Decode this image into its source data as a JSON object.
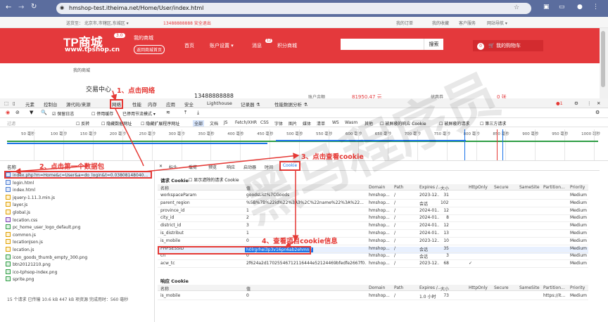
{
  "browser": {
    "url": "hmshop-test.itheima.net/Home/User/index.html"
  },
  "site": {
    "top_left": "送货至：  北京市,市辖区,东城区 ▾",
    "top_phone": "13488888888 安全退出",
    "top_links": [
      "我的订单",
      "我的收藏",
      "客户服务",
      "网站导航 ▾"
    ],
    "logo": "TP商城",
    "logo_badge": "3.0",
    "logo_url": "www.tpshop.cn",
    "my_shop": "我的商城",
    "back_home": "返回商城首页",
    "nav": [
      "首页",
      "账户设置 ▾",
      "消息",
      "积分商城"
    ],
    "msg_badge": "12",
    "search_btn": "搜索",
    "cart_count": "0",
    "cart_label": "我的购物车",
    "breadcrumb": "我的商城",
    "ucenter": "交易中心",
    "phone": "13488888888",
    "balance_label": "账户余额",
    "balance_value": "81950.47 元",
    "coupon_label": "优惠券",
    "coupon_value": "0 张"
  },
  "devtools": {
    "tabs": [
      "元素",
      "控制台",
      "源代码/来源",
      "网络",
      "性能",
      "内存",
      "应用",
      "安全",
      "Lighthouse",
      "记录器 ⚗",
      "性能数据分析 ⚗"
    ],
    "toolbar": {
      "preserve_log": "保留日志",
      "disable_cache": "停用缓存",
      "throttle": "已停用节流模式 ▾"
    },
    "filter": {
      "placeholder": "过滤",
      "invert": "反转",
      "hide_data": "隐藏数据网址",
      "hide_ext": "隐藏扩展程序网址",
      "chips": [
        "全部",
        "文档",
        "JS",
        "Fetch/XHR",
        "CSS",
        "字体",
        "图片",
        "媒体",
        "清单",
        "WS",
        "Wasm",
        "其他"
      ],
      "blocked_cookies": "被屏蔽的响应 Cookie",
      "blocked_requests": "被屏蔽的请求",
      "third_party": "第三方请求"
    },
    "ticks": [
      "50 毫秒",
      "100 毫秒",
      "150 毫秒",
      "200 毫秒",
      "250 毫秒",
      "300 毫秒",
      "350 毫秒",
      "400 毫秒",
      "450 毫秒",
      "500 毫秒",
      "550 毫秒",
      "600 毫秒",
      "650 毫秒",
      "700 毫秒",
      "750 毫秒",
      "800 毫秒",
      "850 毫秒",
      "900 毫秒",
      "950 毫秒",
      "1000 毫秒"
    ],
    "left_header": "名称",
    "files": [
      {
        "name": "index.php?m=Home&c=User&a=do_login&t=0.03808148040...",
        "t": "doc"
      },
      {
        "name": "login.html",
        "t": "doc"
      },
      {
        "name": "index.html",
        "t": "doc"
      },
      {
        "name": "jquery-1.11.3.min.js",
        "t": "js"
      },
      {
        "name": "layer.js",
        "t": "js"
      },
      {
        "name": "global.js",
        "t": "js"
      },
      {
        "name": "location.css",
        "t": "css"
      },
      {
        "name": "pc_home_user_logo_default.png",
        "t": "img"
      },
      {
        "name": "common.js",
        "t": "js"
      },
      {
        "name": "locationJson.js",
        "t": "js"
      },
      {
        "name": "location.js",
        "t": "js"
      },
      {
        "name": "icon_goods_thumb_empty_300.png",
        "t": "img"
      },
      {
        "name": "btn20121210.png",
        "t": "img"
      },
      {
        "name": "ico-tphsop-index.png",
        "t": "img"
      },
      {
        "name": "sprite.png",
        "t": "img"
      }
    ],
    "left_footer": "15 个请求    已传输 10.6 kB    447 kB 项资源    完成用时：560 毫秒",
    "right_tabs": [
      "标头",
      "载荷",
      "预览",
      "响应",
      "启动器",
      "时间",
      "Cookie"
    ],
    "req_section": "请求 Cookie",
    "show_filtered": "显示滤除的请求 Cookie",
    "columns": [
      "名称",
      "值",
      "Domain",
      "Path",
      "Expires /...",
      "大小",
      "HttpOnly",
      "Secure",
      "SameSite",
      "Partition...",
      "Priority"
    ],
    "req_rows": [
      [
        "workspaceParam",
        "goodsList%7CGoods",
        "hmshop...",
        "/",
        "2023-12...",
        "31",
        "",
        "",
        "",
        "",
        "Medium"
      ],
      [
        "parent_region",
        "%5B%7B%22id%22%3A3%2C%22name%22%3A%22...",
        "hmshop...",
        "/",
        "会话",
        "1029",
        "",
        "",
        "",
        "",
        "Medium"
      ],
      [
        "province_id",
        "1",
        "hmshop...",
        "/",
        "2024-01...",
        "12",
        "",
        "",
        "",
        "",
        "Medium"
      ],
      [
        "city_id",
        "2",
        "hmshop...",
        "/",
        "2024-01...",
        "8",
        "",
        "",
        "",
        "",
        "Medium"
      ],
      [
        "district_id",
        "3",
        "hmshop...",
        "/",
        "2024-01...",
        "12",
        "",
        "",
        "",
        "",
        "Medium"
      ],
      [
        "is_distribut",
        "1",
        "hmshop...",
        "/",
        "2024-01...",
        "13",
        "",
        "",
        "",
        "",
        "Medium"
      ],
      [
        "is_mobile",
        "0",
        "hmshop...",
        "/",
        "2023-12...",
        "10",
        "",
        "",
        "",
        "",
        "Medium"
      ],
      [
        "PHPSESSID",
        "h0lrgrhei3p3v16pn6ab2ehmn2",
        "hmshop...",
        "/",
        "会话",
        "35",
        "",
        "",
        "",
        "",
        "Medium"
      ],
      [
        "cn",
        "0",
        "hmshop...",
        "/",
        "会话",
        "3",
        "",
        "",
        "",
        "",
        "Medium"
      ],
      [
        "acw_tc",
        "2f624a2d17025546712116444e52124469bfedfe2667f0...",
        "hmshop...",
        "/",
        "2023-12...",
        "68",
        "✓",
        "",
        "",
        "",
        "Medium"
      ]
    ],
    "resp_section": "响应 Cookie",
    "resp_rows": [
      [
        "is_mobile",
        "0",
        "hmshop...",
        "/",
        "1.0 小时",
        "73",
        "",
        "",
        "",
        "https://it...",
        "Medium"
      ]
    ]
  },
  "annotations": [
    "1、点击网络",
    "2、点击第一个数据包",
    "3、点击查看cookie",
    "4、查看项目cookie信息"
  ],
  "watermark": "黑马程序员",
  "colors": {
    "brand_red": "#e4393c",
    "annotation_red": "#e53935",
    "chrome_blue": "#5b6d9e",
    "select_blue": "#1a73e8"
  }
}
